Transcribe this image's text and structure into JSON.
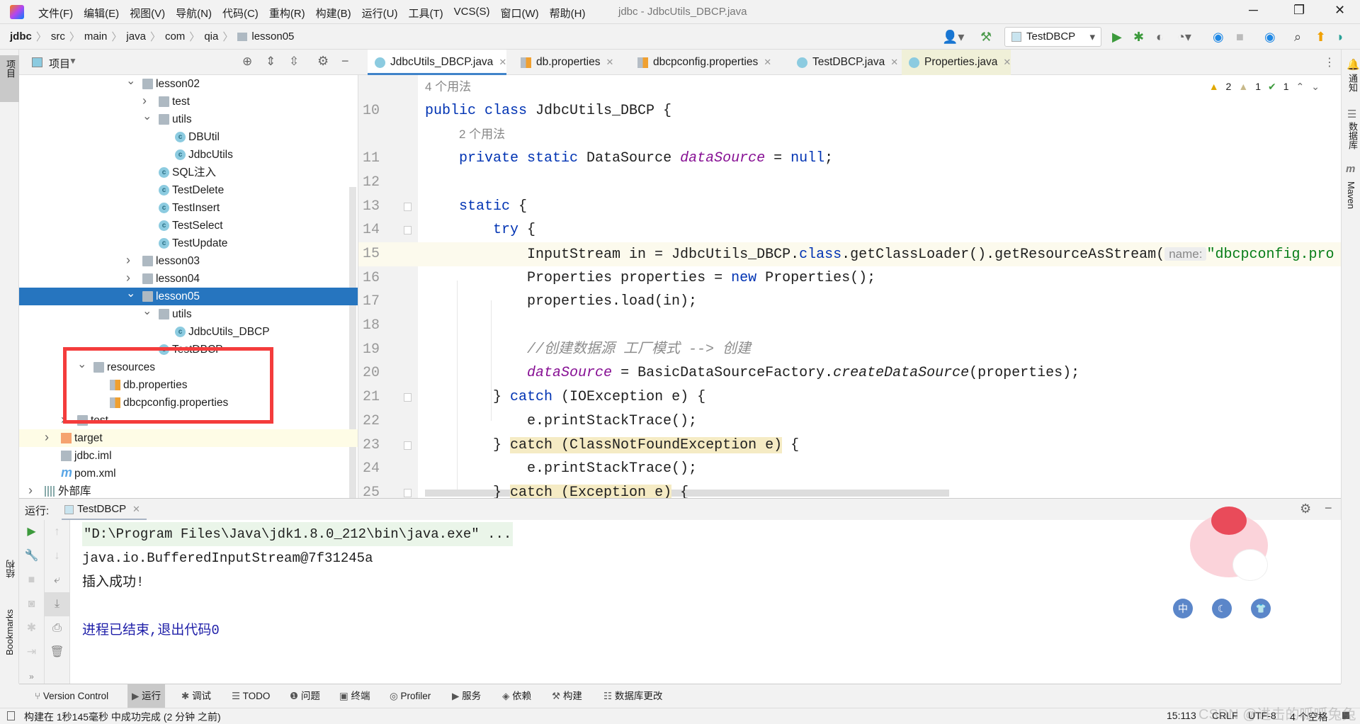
{
  "menu": [
    "文件(F)",
    "编辑(E)",
    "视图(V)",
    "导航(N)",
    "代码(C)",
    "重构(R)",
    "构建(B)",
    "运行(U)",
    "工具(T)",
    "VCS(S)",
    "窗口(W)",
    "帮助(H)"
  ],
  "window_title": "jdbc - JdbcUtils_DBCP.java",
  "breadcrumb": [
    "jdbc",
    "src",
    "main",
    "java",
    "com",
    "qia",
    "lesson05"
  ],
  "run_config": "TestDBCP",
  "left_stripe": [
    "项目",
    "结构",
    "Bookmarks"
  ],
  "right_stripe": [
    "通知",
    "数据库",
    "Maven"
  ],
  "project_panel": {
    "title": "项目"
  },
  "tree": [
    {
      "label": "lesson02",
      "depth": 6,
      "icon": "folder",
      "expanded": true
    },
    {
      "label": "test",
      "depth": 7,
      "icon": "folder",
      "expanded": false
    },
    {
      "label": "utils",
      "depth": 7,
      "icon": "folder",
      "expanded": true
    },
    {
      "label": "DBUtil",
      "depth": 8,
      "icon": "class"
    },
    {
      "label": "JdbcUtils",
      "depth": 8,
      "icon": "class"
    },
    {
      "label": "SQL注入",
      "depth": 7,
      "icon": "class"
    },
    {
      "label": "TestDelete",
      "depth": 7,
      "icon": "class"
    },
    {
      "label": "TestInsert",
      "depth": 7,
      "icon": "class"
    },
    {
      "label": "TestSelect",
      "depth": 7,
      "icon": "class"
    },
    {
      "label": "TestUpdate",
      "depth": 7,
      "icon": "class"
    },
    {
      "label": "lesson03",
      "depth": 6,
      "icon": "folder",
      "expanded": false
    },
    {
      "label": "lesson04",
      "depth": 6,
      "icon": "folder",
      "expanded": false
    },
    {
      "label": "lesson05",
      "depth": 6,
      "icon": "folder",
      "expanded": true,
      "selected": true
    },
    {
      "label": "utils",
      "depth": 7,
      "icon": "folder",
      "expanded": true
    },
    {
      "label": "JdbcUtils_DBCP",
      "depth": 8,
      "icon": "class"
    },
    {
      "label": "TestDBCP",
      "depth": 7,
      "icon": "class"
    },
    {
      "label": "resources",
      "depth": 3,
      "icon": "folder",
      "expanded": true
    },
    {
      "label": "db.properties",
      "depth": 4,
      "icon": "prop"
    },
    {
      "label": "dbcpconfig.properties",
      "depth": 4,
      "icon": "prop"
    },
    {
      "label": "test",
      "depth": 2,
      "icon": "folder",
      "expanded": false
    },
    {
      "label": "target",
      "depth": 1,
      "icon": "target",
      "expanded": false,
      "highlight": true
    },
    {
      "label": "jdbc.iml",
      "depth": 1,
      "icon": "iml"
    },
    {
      "label": "pom.xml",
      "depth": 1,
      "icon": "mvn"
    },
    {
      "label": "外部库",
      "depth": 0,
      "icon": "lib",
      "expanded": false
    }
  ],
  "tabs": [
    {
      "label": "JdbcUtils_DBCP.java",
      "icon": "class",
      "active": true
    },
    {
      "label": "db.properties",
      "icon": "prop"
    },
    {
      "label": "dbcpconfig.properties",
      "icon": "prop"
    },
    {
      "label": "TestDBCP.java",
      "icon": "class"
    },
    {
      "label": "Properties.java",
      "icon": "class",
      "pinned": true
    }
  ],
  "inspections": {
    "warnings": "2",
    "weak_warnings": "1",
    "typos": "1"
  },
  "code": [
    {
      "hint": "4 个用法"
    },
    {
      "n": "10",
      "t": [
        [
          "public class ",
          "kw"
        ],
        [
          "JdbcUtils_DBCP {",
          ""
        ]
      ]
    },
    {
      "hint": "2 个用法",
      "indent": 1
    },
    {
      "n": "11",
      "t": [
        [
          "    private static ",
          "kw"
        ],
        [
          "DataSource ",
          ""
        ],
        [
          "dataSource",
          "fld"
        ],
        [
          " = ",
          ""
        ],
        [
          "null",
          "kw"
        ],
        [
          ";",
          ""
        ]
      ]
    },
    {
      "n": "12",
      "t": []
    },
    {
      "n": "13",
      "t": [
        [
          "    static ",
          "kw"
        ],
        [
          "{",
          ""
        ]
      ]
    },
    {
      "n": "14",
      "t": [
        [
          "        try ",
          "kw"
        ],
        [
          "{",
          ""
        ]
      ]
    },
    {
      "n": "15",
      "current": true,
      "t": [
        [
          "            InputStream in = JdbcUtils_DBCP.",
          ""
        ],
        [
          "class",
          "kw"
        ],
        [
          ".getClassLoader().getResourceAsStream(",
          ""
        ],
        [
          "name:",
          "inlay"
        ],
        [
          "\"dbcpconfig.pro",
          "str"
        ]
      ]
    },
    {
      "n": "16",
      "t": [
        [
          "            Properties properties = ",
          ""
        ],
        [
          "new ",
          "kw"
        ],
        [
          "Properties();",
          ""
        ]
      ]
    },
    {
      "n": "17",
      "t": [
        [
          "            properties.load(in);",
          ""
        ]
      ]
    },
    {
      "n": "18",
      "t": []
    },
    {
      "n": "19",
      "t": [
        [
          "            //创建数据源 工厂模式 --> 创建",
          "cmt"
        ]
      ]
    },
    {
      "n": "20",
      "t": [
        [
          "            ",
          ""
        ],
        [
          "dataSource",
          "fld"
        ],
        [
          " = BasicDataSourceFactory.",
          ""
        ],
        [
          "createDataSource",
          "it"
        ],
        [
          "(properties);",
          ""
        ]
      ]
    },
    {
      "n": "21",
      "t": [
        [
          "        } ",
          ""
        ],
        [
          "catch ",
          "kw"
        ],
        [
          "(IOException e) {",
          ""
        ]
      ]
    },
    {
      "n": "22",
      "t": [
        [
          "            e.printStackTrace();",
          ""
        ]
      ]
    },
    {
      "n": "23",
      "t": [
        [
          "        } ",
          ""
        ],
        [
          "catch (ClassNotFoundException e)",
          "mark"
        ],
        [
          " {",
          ""
        ]
      ]
    },
    {
      "n": "24",
      "t": [
        [
          "            e.printStackTrace();",
          ""
        ]
      ]
    },
    {
      "n": "25",
      "t": [
        [
          "        } ",
          ""
        ],
        [
          "catch (Exception e)",
          "mark"
        ],
        [
          " {",
          ""
        ]
      ]
    }
  ],
  "run": {
    "label": "运行:",
    "tab": "TestDBCP",
    "console": [
      {
        "text": "\"D:\\Program Files\\Java\\jdk1.8.0_212\\bin\\java.exe\" ...",
        "kind": "cmd"
      },
      {
        "text": "java.io.BufferedInputStream@7f31245a",
        "kind": "out"
      },
      {
        "text": "插入成功!",
        "kind": "out"
      },
      {
        "text": "",
        "kind": "out"
      },
      {
        "text": "进程已结束,退出代码0",
        "kind": "exit"
      }
    ],
    "widget_buttons": [
      "中",
      "☾",
      "👕"
    ]
  },
  "bottom_tools": [
    "Version Control",
    "运行",
    "调试",
    "TODO",
    "问题",
    "终端",
    "Profiler",
    "服务",
    "依赖",
    "构建",
    "数据库更改"
  ],
  "bottom_active": "运行",
  "status": {
    "message": "构建在 1秒145毫秒 中成功完成 (2 分钟 之前)",
    "position": "15:113",
    "line_sep": "CRLF",
    "encoding": "UTF-8",
    "indent": "4 个空格"
  },
  "watermark": "CSDN @进击的呱呱兔兔",
  "colors": {
    "selection": "#2675bf",
    "keyword": "#0033b3",
    "field": "#871094",
    "string": "#067d17",
    "redbox": "#f43c3c",
    "exit_text": "#1e1ea8"
  }
}
